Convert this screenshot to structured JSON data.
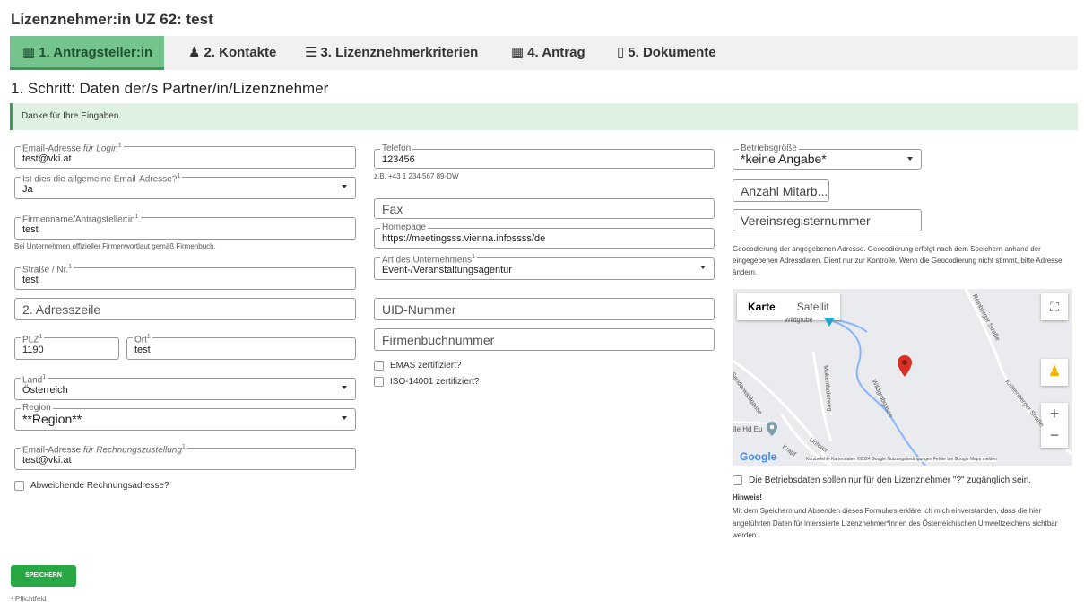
{
  "page": {
    "title": "Lizenznehmer:in UZ 62: test"
  },
  "tabs": [
    {
      "icon": "building-icon",
      "glyph": "▦",
      "label": "1. Antragsteller:in"
    },
    {
      "icon": "person-icon",
      "glyph": "♟",
      "label": "2. Kontakte"
    },
    {
      "icon": "checklist-icon",
      "glyph": "☰",
      "label": "3. Lizenznehmerkriterien"
    },
    {
      "icon": "building-icon",
      "glyph": "▦",
      "label": "4. Antrag"
    },
    {
      "icon": "document-icon",
      "glyph": "▯",
      "label": "5. Dokumente"
    }
  ],
  "step_title": "1. Schritt: Daten der/s Partner/in/Lizenznehmer",
  "alert": "Danke für Ihre Eingaben.",
  "col1": {
    "email": {
      "label": "Email-Adresse ",
      "label_em": "für Login",
      "sup": "1",
      "value": "test@vki.at"
    },
    "general_email": {
      "label": "Ist dies die allgemeine Email-Adresse?",
      "sup": "1",
      "value": "Ja"
    },
    "company": {
      "label": "Firmenname/Antragsteller:in",
      "sup": "1",
      "value": "test",
      "help": "Bei Unternehmen offizieller Firmenwortlaut gemäß Firmenbuch."
    },
    "street": {
      "label": "Straße / Nr.",
      "sup": "1",
      "value": "test"
    },
    "address2": {
      "placeholder": "2. Adresszeile"
    },
    "zip": {
      "label": "PLZ",
      "sup": "1",
      "value": "1190"
    },
    "city": {
      "label": "Ort",
      "sup": "1",
      "value": "test"
    },
    "country": {
      "label": "Land",
      "sup": "1",
      "value": "Österreich"
    },
    "region": {
      "label": "Region",
      "value": "**Region**"
    },
    "invoice_email": {
      "label": "Email-Adresse ",
      "label_em": "für Rechnungszustellung",
      "sup": "1",
      "value": "test@vki.at"
    },
    "alt_invoice": {
      "label": "Abweichende Rechnungsadresse?"
    }
  },
  "col2": {
    "phone": {
      "label": "Telefon",
      "value": "123456",
      "help": "z.B. +43 1 234 567 89-DW"
    },
    "fax": {
      "placeholder": "Fax"
    },
    "homepage": {
      "label": "Homepage",
      "value": "https://meetingsss.vienna.infossss/de"
    },
    "company_type": {
      "label": "Art des Unternehmens",
      "sup": "1",
      "value": "Event-/Veranstaltungsagentur"
    },
    "uid": {
      "placeholder": "UID-Nummer"
    },
    "register": {
      "placeholder": "Firmenbuchnummer"
    },
    "emas": {
      "label": "EMAS zertifiziert?"
    },
    "iso": {
      "label": "ISO-14001 zertifiziert?"
    }
  },
  "col3": {
    "size": {
      "label": "Betriebsgröße",
      "value": "*keine Angabe*"
    },
    "employees": {
      "placeholder": "Anzahl Mitarb..."
    },
    "club_register": {
      "placeholder": "Vereinsregisternummer"
    },
    "geo_text": "Geocodierung der angegebenen Adresse. Geocodierung erfolgt nach dem Speichern anhand der eingegebenen Adressdaten. Dient nur zur Kontrolle. Wenn die Geocodierung nicht stimmt, bitte Adresse ändern.",
    "map": {
      "tab_map": "Karte",
      "tab_satellite": "Satellit",
      "labels": {
        "wildgrube_top": "Wildgrube",
        "wildgrubgasse": "Wildgrubgasse",
        "mukenthalerweg": "Mukenthalerweg",
        "waldgasse": "Senderwaldgasse",
        "reinberger": "Reinberger Straße",
        "kahlenberger": "Kahlenberger Straße",
        "unterer": "Unterer",
        "krapf": "Krapf",
        "poi": "lle Hd Eu"
      },
      "google": "Google",
      "footer": "Kurzbefehle   Kartendaten ©2024 Google   Nutzungsbedingungen   Fehler bei Google Maps melden"
    },
    "visibility": {
      "label": "Die Betriebsdaten sollen nur für den Lizenznehmer \"?\" zugänglich sein."
    },
    "note_heading": "Hinweis!",
    "note": "Mit dem Speichern und Absenden dieses Formulars erkläre ich mich einverstanden, dass die hier angeführten Daten für interssierte Lizenznehmer*innen des Österreichischen Umweltzeichens sichtbar werden."
  },
  "save_label": "SPEICHERN",
  "footnote": "¹ Pflichtfeld",
  "colors": {
    "accent_green": "#28a745",
    "tab_active": "#76c48d",
    "alert_bg": "#dff1e3",
    "map_pin": "#d93025"
  }
}
